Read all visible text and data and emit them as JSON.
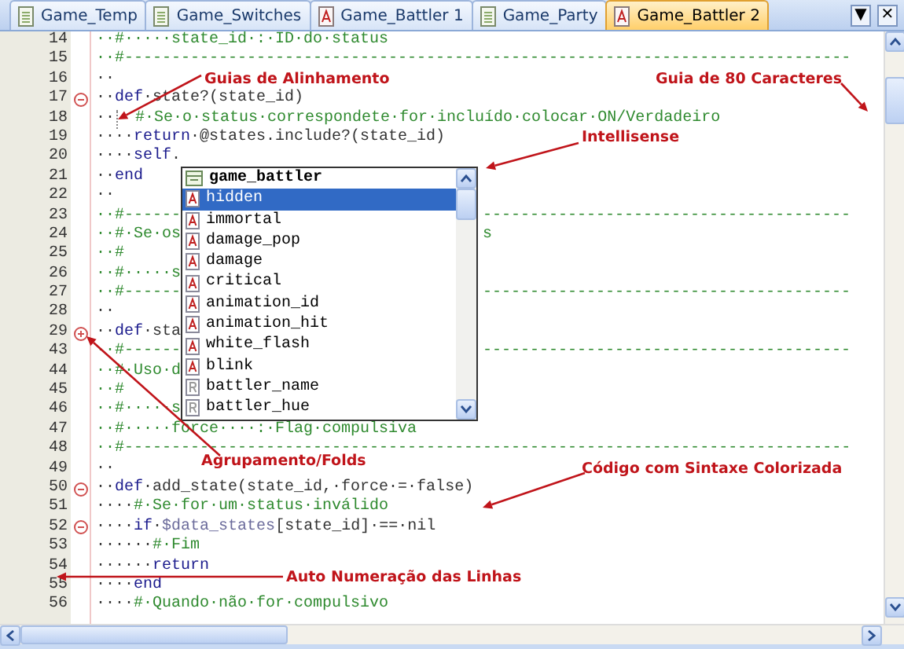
{
  "tabs": [
    {
      "label": "Game_Temp",
      "kind": "page",
      "selected": false
    },
    {
      "label": "Game_Switches",
      "kind": "page",
      "selected": false
    },
    {
      "label": "Game_Battler 1",
      "kind": "script",
      "selected": false
    },
    {
      "label": "Game_Party",
      "kind": "page",
      "selected": false
    },
    {
      "label": "Game_Battler 2",
      "kind": "script",
      "selected": true
    }
  ],
  "tab_buttons": [
    "▼",
    "✕"
  ],
  "lines": [
    {
      "number": "14",
      "code": [
        {
          "kind": "comment",
          "text": "··#·····state_id·:·ID·do·status"
        }
      ]
    },
    {
      "number": "15",
      "code": [
        {
          "kind": "comment",
          "text": "··#-----------------------------------------------------------------------------"
        }
      ]
    },
    {
      "number": "16",
      "code": [
        {
          "kind": "plain",
          "text": "··"
        }
      ]
    },
    {
      "number": "17",
      "expanded": true,
      "code": [
        {
          "kind": "plain",
          "text": "··"
        },
        {
          "kind": "keyword",
          "text": "def"
        },
        {
          "kind": "plain",
          "text": "·state?(state_id)"
        }
      ]
    },
    {
      "number": "18",
      "code": [
        {
          "kind": "plain",
          "text": "··"
        },
        {
          "kind": "guide"
        },
        {
          "kind": "comment",
          "text": "#·Se·o·status·correspondete·for·incluído·colocar·ON/Verdadeiro"
        }
      ]
    },
    {
      "number": "19",
      "code": [
        {
          "kind": "plain",
          "text": "····"
        },
        {
          "kind": "keyword",
          "text": "return"
        },
        {
          "kind": "plain",
          "text": "·@states.include?(state_id)"
        }
      ]
    },
    {
      "number": "20",
      "code": [
        {
          "kind": "plain",
          "text": "····"
        },
        {
          "kind": "keyword",
          "text": "self"
        },
        {
          "kind": "plain",
          "text": "."
        }
      ]
    },
    {
      "number": "21",
      "code": [
        {
          "kind": "plain",
          "text": "··"
        },
        {
          "kind": "keyword",
          "text": "end"
        }
      ]
    },
    {
      "number": "22",
      "code": [
        {
          "kind": "plain",
          "text": "··"
        }
      ]
    },
    {
      "number": "23",
      "code": [
        {
          "kind": "comment",
          "text": "··#------"
        }
      ],
      "after": [
        {
          "kind": "comment",
          "text": "---------------------------------------"
        }
      ]
    },
    {
      "number": "24",
      "code": [
        {
          "kind": "comment",
          "text": "··#·Se·os"
        }
      ],
      "after": [
        {
          "kind": "comment",
          "text": "s"
        }
      ]
    },
    {
      "number": "25",
      "code": [
        {
          "kind": "comment",
          "text": "··#"
        }
      ]
    },
    {
      "number": "26",
      "code": [
        {
          "kind": "comment",
          "text": "··#·····s"
        }
      ]
    },
    {
      "number": "27",
      "code": [
        {
          "kind": "comment",
          "text": "··#------"
        }
      ],
      "after": [
        {
          "kind": "comment",
          "text": "---------------------------------------"
        }
      ]
    },
    {
      "number": "28",
      "code": [
        {
          "kind": "plain",
          "text": "··"
        }
      ]
    },
    {
      "number": "29",
      "expanded": false,
      "code": [
        {
          "kind": "plain",
          "text": "··"
        },
        {
          "kind": "keyword",
          "text": "def"
        },
        {
          "kind": "plain",
          "text": "·sta"
        }
      ]
    },
    {
      "number": "43",
      "code": [
        {
          "kind": "comment",
          "text": "··#------"
        }
      ],
      "after": [
        {
          "kind": "comment",
          "text": "---------------------------------------"
        }
      ]
    },
    {
      "number": "44",
      "code": [
        {
          "kind": "comment",
          "text": "··#·Uso·d"
        }
      ]
    },
    {
      "number": "45",
      "code": [
        {
          "kind": "comment",
          "text": "··#"
        }
      ]
    },
    {
      "number": "46",
      "code": [
        {
          "kind": "comment",
          "text": "··#·····s"
        }
      ]
    },
    {
      "number": "47",
      "code": [
        {
          "kind": "comment",
          "text": "··#·····force····:·Flag·compulsiva"
        }
      ]
    },
    {
      "number": "48",
      "code": [
        {
          "kind": "comment",
          "text": "··#-----------------------------------------------------------------------------"
        }
      ]
    },
    {
      "number": "49",
      "code": [
        {
          "kind": "plain",
          "text": "··"
        }
      ]
    },
    {
      "number": "50",
      "expanded": true,
      "code": [
        {
          "kind": "plain",
          "text": "··"
        },
        {
          "kind": "keyword",
          "text": "def"
        },
        {
          "kind": "plain",
          "text": "·add_state(state_id,·force·=·false)"
        }
      ]
    },
    {
      "number": "51",
      "code": [
        {
          "kind": "plain",
          "text": "····"
        },
        {
          "kind": "comment",
          "text": "#·Se·for·um·status·inválido"
        }
      ]
    },
    {
      "number": "52",
      "expanded": true,
      "code": [
        {
          "kind": "plain",
          "text": "····"
        },
        {
          "kind": "keyword",
          "text": "if"
        },
        {
          "kind": "plain",
          "text": "·"
        },
        {
          "kind": "global",
          "text": "$data_states"
        },
        {
          "kind": "plain",
          "text": "[state_id]·==·nil"
        }
      ]
    },
    {
      "number": "53",
      "code": [
        {
          "kind": "plain",
          "text": "······"
        },
        {
          "kind": "comment",
          "text": "#·Fim"
        }
      ]
    },
    {
      "number": "54",
      "code": [
        {
          "kind": "plain",
          "text": "······"
        },
        {
          "kind": "keyword",
          "text": "return"
        }
      ]
    },
    {
      "number": "55",
      "code": [
        {
          "kind": "plain",
          "text": "····"
        },
        {
          "kind": "keyword",
          "text": "end"
        }
      ]
    },
    {
      "number": "56",
      "code": [
        {
          "kind": "plain",
          "text": "····"
        },
        {
          "kind": "comment",
          "text": "#·Quando·não·for·compulsivo"
        }
      ]
    }
  ],
  "intellisense": {
    "header": "game_battler",
    "items": [
      {
        "label": "hidden",
        "kind": "attribute",
        "selected": true
      },
      {
        "label": "immortal",
        "kind": "attribute",
        "selected": false
      },
      {
        "label": "damage_pop",
        "kind": "attribute",
        "selected": false
      },
      {
        "label": "damage",
        "kind": "attribute",
        "selected": false
      },
      {
        "label": "critical",
        "kind": "attribute",
        "selected": false
      },
      {
        "label": "animation_id",
        "kind": "attribute",
        "selected": false
      },
      {
        "label": "animation_hit",
        "kind": "attribute",
        "selected": false
      },
      {
        "label": "white_flash",
        "kind": "attribute",
        "selected": false
      },
      {
        "label": "blink",
        "kind": "attribute",
        "selected": false
      },
      {
        "label": "battler_name",
        "kind": "reader",
        "selected": false
      },
      {
        "label": "battler_hue",
        "kind": "reader",
        "selected": false
      }
    ]
  },
  "annotations": [
    {
      "text": "Guias de Alinhamento"
    },
    {
      "text": "Guia de 80 Caracteres"
    },
    {
      "text": "Intellisense"
    },
    {
      "text": "Agrupamento/Folds"
    },
    {
      "text": "Código com Sintaxe Colorizada"
    },
    {
      "text": "Auto Numeração das Linhas"
    }
  ]
}
